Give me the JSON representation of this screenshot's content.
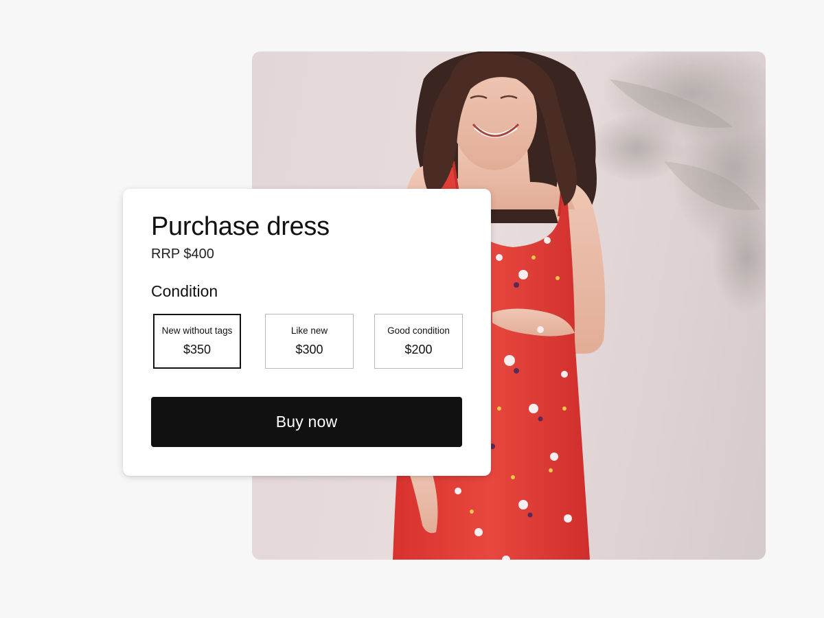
{
  "purchase_card": {
    "title": "Purchase dress",
    "rrp": "RRP $400",
    "condition_heading": "Condition",
    "options": [
      {
        "label": "New without tags",
        "price": "$350",
        "selected": true
      },
      {
        "label": "Like new",
        "price": "$300",
        "selected": false
      },
      {
        "label": "Good condition",
        "price": "$200",
        "selected": false
      }
    ],
    "buy_label": "Buy now"
  },
  "colors": {
    "page_background": "#f7f7f7",
    "card_background": "#ffffff",
    "button_background": "#111111",
    "button_text": "#ffffff",
    "selected_border": "#111111",
    "option_border": "#b9b9b9",
    "dress": "#e0403c",
    "wall": "#e6dada"
  }
}
